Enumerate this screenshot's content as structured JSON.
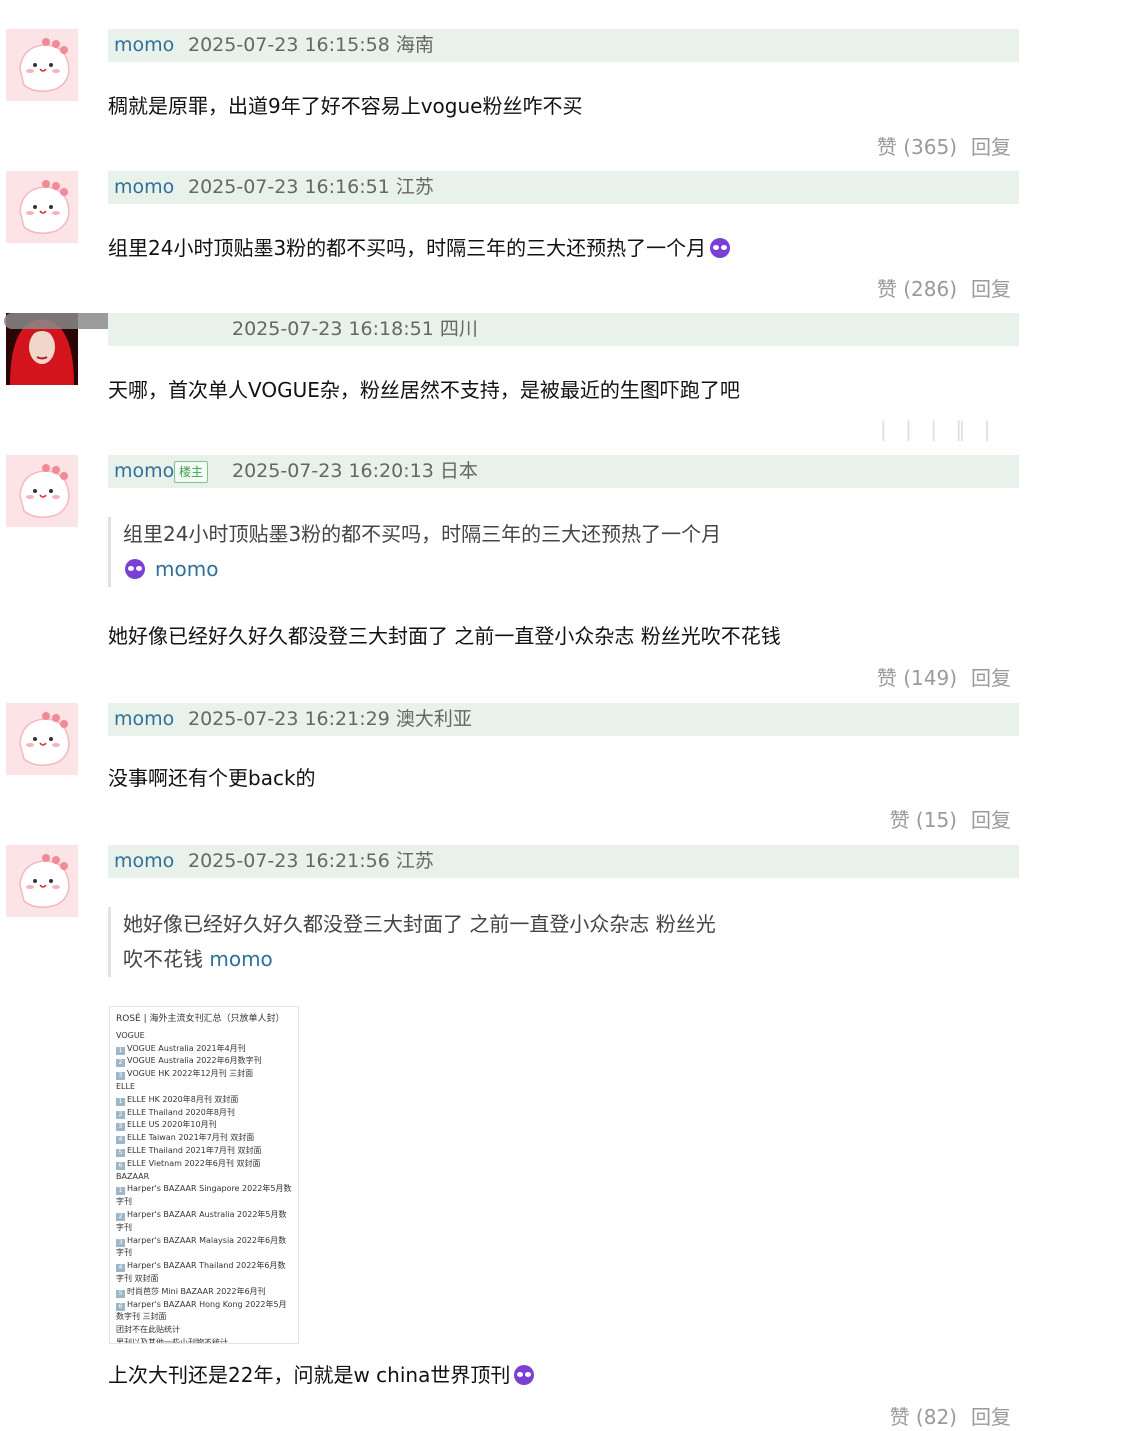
{
  "comments": [
    {
      "user": "momo",
      "time": "2025-07-23 16:15:58 海南",
      "text": "稠就是原罪，出道9年了好不容易上vogue粉丝咋不买",
      "likes": "赞 (365)",
      "reply": "回复"
    },
    {
      "user": "momo",
      "time": "2025-07-23 16:16:51 江苏",
      "text": "组里24小时顶贴墨3粉的都不买吗，时隔三年的三大还预热了一个月",
      "likes": "赞 (286)",
      "reply": "回复"
    },
    {
      "user": "",
      "time": "2025-07-23 16:18:51 四川",
      "text": "天哪，首次单人VOGUE杂，粉丝居然不支持，是被最近的生图吓跑了吧"
    },
    {
      "user": "momo",
      "badge": "楼主",
      "time": "2025-07-23 16:20:13 日本",
      "quote_text": "组里24小时顶贴墨3粉的都不买吗，时隔三年的三大还预热了一个月",
      "quote_user": "momo",
      "text": "她好像已经好久好久都没登三大封面了 之前一直登小众杂志 粉丝光吹不花钱",
      "likes": "赞 (149)",
      "reply": "回复"
    },
    {
      "user": "momo",
      "time": "2025-07-23 16:21:29 澳大利亚",
      "text": "没事啊还有个更back的",
      "likes": "赞 (15)",
      "reply": "回复"
    },
    {
      "user": "momo",
      "time": "2025-07-23 16:21:56 江苏",
      "quote_line1": "她好像已经好久好久都没登三大封面了 之前一直登小众杂志 粉丝光",
      "quote_line2": "吹不花钱",
      "quote_user": "momo",
      "text": "上次大刊还是22年，问就是w china世界顶刊",
      "likes": "赞 (82)",
      "reply": "回复"
    }
  ],
  "image": {
    "title": "ROSÉ | 海外主流女刊汇总（只放单人封）",
    "rows": [
      {
        "num": "",
        "text": "VOGUE"
      },
      {
        "num": "1",
        "text": "VOGUE Australia 2021年4月刊"
      },
      {
        "num": "2",
        "text": "VOGUE Australia 2022年6月数字刊"
      },
      {
        "num": "3",
        "text": "VOGUE HK 2022年12月刊 三封面"
      },
      {
        "num": "",
        "text": "ELLE"
      },
      {
        "num": "1",
        "text": "ELLE HK 2020年8月刊 双封面"
      },
      {
        "num": "2",
        "text": "ELLE Thailand 2020年8月刊"
      },
      {
        "num": "3",
        "text": "ELLE US 2020年10月刊"
      },
      {
        "num": "4",
        "text": "ELLE Taiwan 2021年7月刊 双封面"
      },
      {
        "num": "5",
        "text": "ELLE Thailand 2021年7月刊 双封面"
      },
      {
        "num": "6",
        "text": "ELLE Vietnam 2022年6月刊 双封面"
      },
      {
        "num": "",
        "text": "BAZAAR"
      },
      {
        "num": "1",
        "text": "Harper's BAZAAR Singapore 2022年5月数"
      },
      {
        "num": "",
        "text": "字刊"
      },
      {
        "num": "2",
        "text": "Harper's BAZAAR Australia 2022年5月数"
      },
      {
        "num": "",
        "text": "字刊"
      },
      {
        "num": "3",
        "text": "Harper's BAZAAR Malaysia 2022年6月数"
      },
      {
        "num": "",
        "text": "字刊"
      },
      {
        "num": "4",
        "text": "Harper's BAZAAR Thailand 2022年6月数"
      },
      {
        "num": "",
        "text": "字刊 双封面"
      },
      {
        "num": "5",
        "text": "时尚芭莎 Mini BAZAAR 2022年6月刊"
      },
      {
        "num": "6",
        "text": "Harper's BAZAAR Hong Kong 2022年5月"
      },
      {
        "num": "",
        "text": "数字刊 三封面"
      },
      {
        "num": "",
        "text": "团封不在此贴统计"
      },
      {
        "num": "",
        "text": "男刊以及其他一些小刊物不统计"
      }
    ]
  },
  "colors": {
    "username": "#2e6f9c",
    "meta_bg": "#e9f2ea",
    "action_text": "#9a9a9a",
    "badge": "#3ea04f",
    "emoji": "#7b3fd3"
  }
}
